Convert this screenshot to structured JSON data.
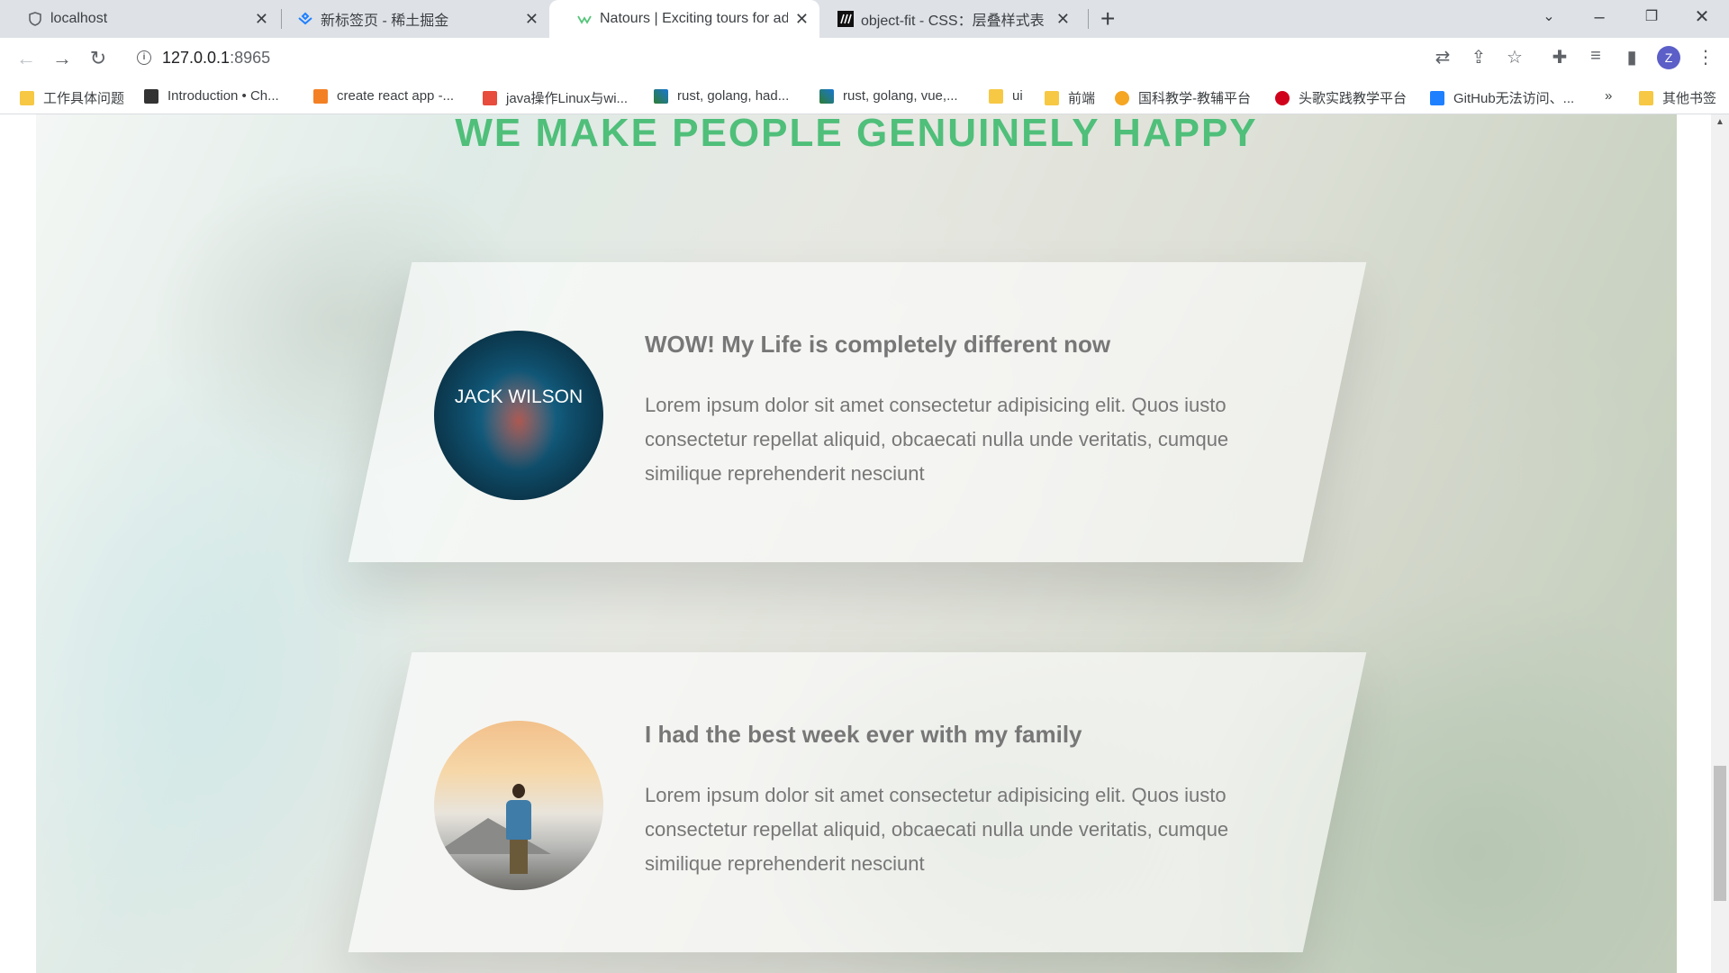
{
  "tabs": [
    {
      "title": "localhost",
      "active": false
    },
    {
      "title": "新标签页 - 稀土掘金",
      "active": false
    },
    {
      "title": "Natours | Exciting tours for ad",
      "active": true
    },
    {
      "title": "object-fit - CSS：层叠样式表 | M",
      "active": false
    }
  ],
  "address": {
    "host": "127.0.0.1",
    "port": ":8965"
  },
  "avatar_letter": "Z",
  "bookmarks": [
    "工作具体问题",
    "Introduction • Ch...",
    "create react app -...",
    "java操作Linux与wi...",
    "rust, golang, had...",
    "rust, golang, vue,...",
    "ui",
    "前端",
    "国科教学-教辅平台",
    "头歌实践教学平台",
    "GitHub无法访问、...",
    "»",
    "其他书签"
  ],
  "page": {
    "section_title": "WE MAKE PEOPLE GENUINELY HAPPY",
    "stories": [
      {
        "caption": "JACK WILSON",
        "heading": "WOW! My Life is completely different now",
        "text": "Lorem ipsum dolor sit amet consectetur adipisicing elit. Quos iusto consectetur repellat aliquid, obcaecati nulla unde veritatis, cumque similique reprehenderit nesciunt"
      },
      {
        "caption": "",
        "heading": "I had the best week ever with my family",
        "text": "Lorem ipsum dolor sit amet consectetur adipisicing elit. Quos iusto consectetur repellat aliquid, obcaecati nulla unde veritatis, cumque similique reprehenderit nesciunt"
      }
    ]
  },
  "colors": {
    "title_green": "#4fbf7a",
    "text_grey": "#777777"
  }
}
